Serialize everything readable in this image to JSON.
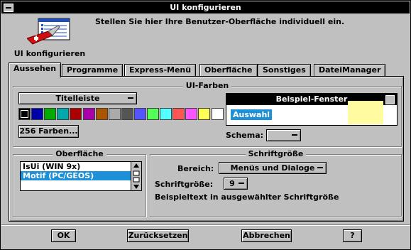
{
  "window": {
    "title": "UI konfigurieren"
  },
  "header": {
    "icon_name": "ui-config-icon",
    "icon_label": "UI konfigurieren",
    "description": "Stellen Sie hier Ihre Benutzer-Oberfläche individuell ein."
  },
  "tabs": [
    {
      "label": "Aussehen",
      "active": true
    },
    {
      "label": "Programme",
      "active": false
    },
    {
      "label": "Express-Menü",
      "active": false
    },
    {
      "label": "Oberfläche",
      "active": false
    },
    {
      "label": "Sonstiges",
      "active": false
    },
    {
      "label": "DateiManager",
      "active": false
    }
  ],
  "colors_group": {
    "title": "UI-Farben",
    "element_select": "Titelleiste",
    "more_colors_button": "256 Farben...",
    "palette": [
      "#000000",
      "#0000aa",
      "#00aa00",
      "#00aaaa",
      "#aa0000",
      "#aa00aa",
      "#aa5500",
      "#aaaaaa",
      "#555555",
      "#5555ff",
      "#55ff55",
      "#55ffff",
      "#ff5555",
      "#ff55ff",
      "#ffff55",
      "#ffffff"
    ],
    "selected_index": 0
  },
  "preview": {
    "title": "Beispiel-Fenster",
    "selection_label": "Auswahl",
    "schema_label": "Schema:",
    "schema_value": ""
  },
  "surface_group": {
    "title": "Oberfläche",
    "items": [
      {
        "label": "IsUi (WIN 9x)",
        "selected": false
      },
      {
        "label": "Motif (PC/GEOS)",
        "selected": true
      }
    ]
  },
  "font_group": {
    "title": "Schriftgröße",
    "area_label": "Bereich:",
    "area_value": "Menüs und Dialoge",
    "size_label": "Schriftgröße:",
    "size_value": "9",
    "sample_text": "Beispieltext in ausgewählter Schriftgröße"
  },
  "buttons": {
    "ok": "OK",
    "reset": "Zurücksetzen",
    "cancel": "Abbrechen",
    "help": "?"
  }
}
